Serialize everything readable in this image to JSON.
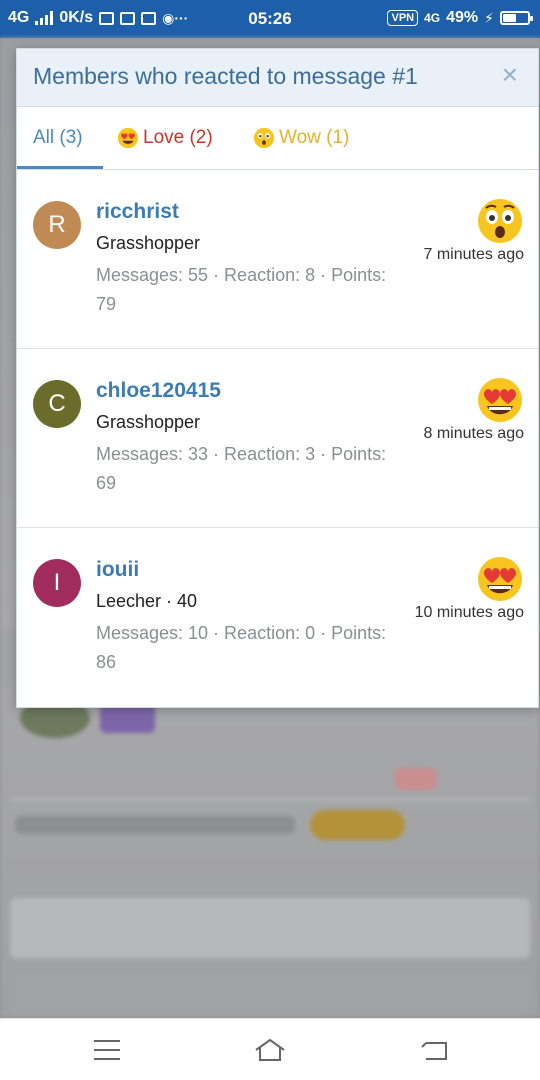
{
  "status_bar": {
    "network": "4G",
    "speed": "0K/s",
    "time": "05:26",
    "vpn": "VPN",
    "network_right": "4G",
    "battery": "49%",
    "battery_level": 0.49
  },
  "modal": {
    "title": "Members who reacted to message #1",
    "close": "×",
    "tabs": [
      {
        "label": "All (3)"
      },
      {
        "label": "Love (2)",
        "icon": "heart-eyes-emoji"
      },
      {
        "label": "Wow (1)",
        "icon": "wow-emoji"
      }
    ],
    "members": [
      {
        "initial": "R",
        "avatar_color": "#c08a55",
        "name": "ricchrist",
        "title": "Grasshopper",
        "stats": "Messages: 55 · Reaction: 8 · Points: 79",
        "reaction": "wow-emoji",
        "time": "7 minutes ago"
      },
      {
        "initial": "C",
        "avatar_color": "#6b6b2b",
        "name": "chloe120415",
        "title": "Grasshopper",
        "stats": "Messages: 33 · Reaction: 3 · Points: 69",
        "reaction": "heart-eyes-emoji",
        "time": "8 minutes ago"
      },
      {
        "initial": "I",
        "avatar_color": "#a12d5f",
        "name": "iouii",
        "title": "Leecher · 40",
        "stats": "Messages: 10 · Reaction: 0 · Points: 86",
        "reaction": "heart-eyes-emoji",
        "time": "10 minutes ago"
      }
    ]
  },
  "nav": {
    "icons": [
      "menu-icon",
      "home-icon",
      "back-icon"
    ]
  },
  "colors": {
    "accent": "#4b88c7",
    "love": "#c9352a",
    "wow": "#e6b22b",
    "username": "#3c7cb4"
  }
}
